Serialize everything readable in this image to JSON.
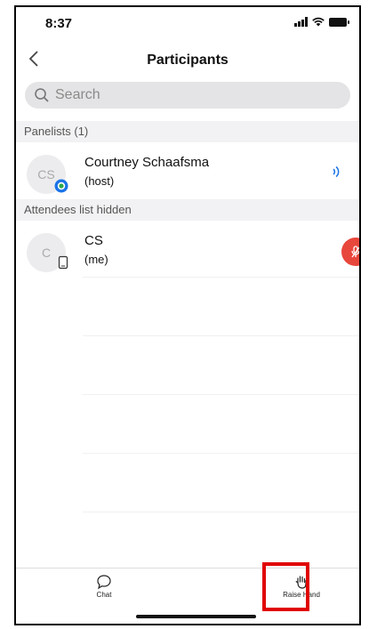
{
  "status_bar": {
    "time": "8:37"
  },
  "nav": {
    "title": "Participants"
  },
  "search": {
    "placeholder": "Search"
  },
  "panelists": {
    "header": "Panelists (1)",
    "items": [
      {
        "initials": "CS",
        "name": "Courtney Schaafsma",
        "role": "(host)"
      }
    ]
  },
  "attendees": {
    "header": "Attendees list hidden",
    "items": [
      {
        "initials": "C",
        "name": "CS",
        "role": "(me)"
      }
    ]
  },
  "tabbar": {
    "chat_label": "Chat",
    "raise_hand_label": "Raise Hand"
  },
  "colors": {
    "accent": "#1a73e8",
    "mute_red": "#e8473c",
    "highlight": "#e00000"
  },
  "icons": [
    "back-chevron-icon",
    "search-icon",
    "audio-wave-icon",
    "microphone-muted-icon",
    "mobile-device-icon",
    "chat-icon",
    "raise-hand-icon"
  ]
}
